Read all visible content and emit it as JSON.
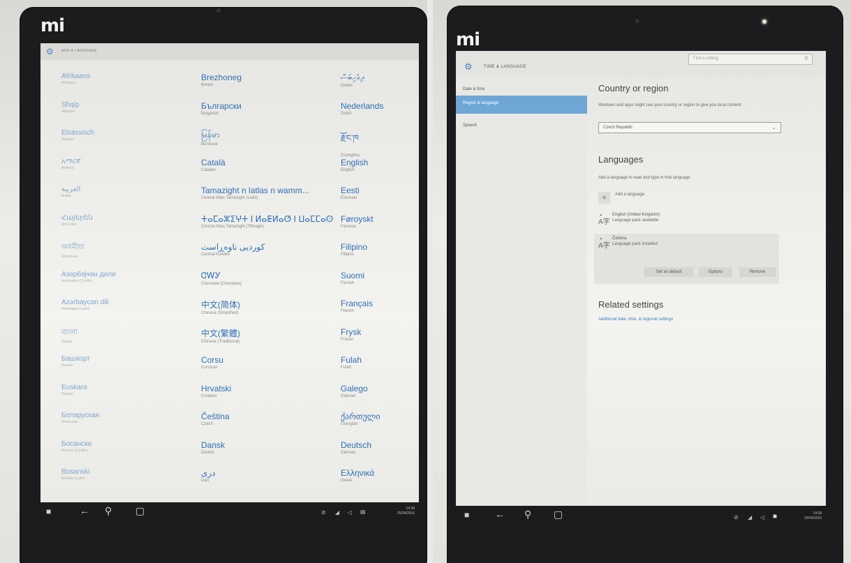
{
  "left_photo": {
    "brand": "mi",
    "header_title": "ADD A LANGUAGE",
    "columns": [
      [
        {
          "name": "Afrikaans",
          "sub": "Afrikaans"
        },
        {
          "name": "Shqip",
          "sub": "Albanian"
        },
        {
          "name": "Elsässisch",
          "sub": "Alsatian"
        },
        {
          "name": "አማርኛ",
          "sub": "Amharic"
        },
        {
          "name": "العربية",
          "sub": "Arabic"
        },
        {
          "name": "Հայերեն",
          "sub": "Armenian"
        },
        {
          "name": "অসমীয়া",
          "sub": "Assamese"
        },
        {
          "name": "Азәрбајҹан дили",
          "sub": "Azerbaijani (Cyrillic)"
        },
        {
          "name": "Azərbaycan dili",
          "sub": "Azerbaijani (Latin)"
        },
        {
          "name": "বাংলা",
          "sub": "Bangla"
        },
        {
          "name": "Башҡорт",
          "sub": "Bashkir"
        },
        {
          "name": "Euskara",
          "sub": "Basque"
        },
        {
          "name": "Беларуская",
          "sub": "Belarusian"
        },
        {
          "name": "Босански",
          "sub": "Bosnian (Cyrillic)"
        },
        {
          "name": "Bosanski",
          "sub": "Bosnian (Latin)"
        }
      ],
      [
        {
          "name": "Brezhoneg",
          "sub": "Breton"
        },
        {
          "name": "Български",
          "sub": "Bulgarian"
        },
        {
          "name": "မြန်မာ",
          "sub": "Burmese"
        },
        {
          "name": "Català",
          "sub": "Catalan"
        },
        {
          "name": "Tamazight n latlas n wamm...",
          "sub": "Central Atlas Tamazight (Latin)"
        },
        {
          "name": "ⵜⴰⵎⴰⵣⵉⵖⵜ ⵏ ⵍⴰⵟⵍⴰⵚ ⵏ ⵡⴰⵎⵎⴰⵙ",
          "sub": "Central Atlas Tamazight (Tifinagh)"
        },
        {
          "name": "کوردیی ناوەڕاست",
          "sub": "Central Kurdish"
        },
        {
          "name": "ᏣᎳᎩ",
          "sub": "Cherokee (Cherokee)"
        },
        {
          "name": "中文(简体)",
          "sub": "Chinese (Simplified)"
        },
        {
          "name": "中文(繁體)",
          "sub": "Chinese (Traditional)"
        },
        {
          "name": "Corsu",
          "sub": "Corsican"
        },
        {
          "name": "Hrvatski",
          "sub": "Croatian"
        },
        {
          "name": "Čeština",
          "sub": "Czech"
        },
        {
          "name": "Dansk",
          "sub": "Danish"
        },
        {
          "name": "دری",
          "sub": "Dari"
        }
      ],
      [
        {
          "name": "ދިވެހިބަސް",
          "sub": "Divehi"
        },
        {
          "name": "Nederlands",
          "sub": "Dutch"
        },
        {
          "name": "རྫོང་ཁ",
          "sub": "Dzongkha"
        },
        {
          "name": "English",
          "sub": "English"
        },
        {
          "name": "Eesti",
          "sub": "Estonian"
        },
        {
          "name": "Føroyskt",
          "sub": "Faroese"
        },
        {
          "name": "Filipino",
          "sub": "Filipino"
        },
        {
          "name": "Suomi",
          "sub": "Finnish"
        },
        {
          "name": "Français",
          "sub": "French"
        },
        {
          "name": "Frysk",
          "sub": "Frisian"
        },
        {
          "name": "Fulah",
          "sub": "Fulah"
        },
        {
          "name": "Galego",
          "sub": "Galician"
        },
        {
          "name": "ქართული",
          "sub": "Georgian"
        },
        {
          "name": "Deutsch",
          "sub": "German"
        },
        {
          "name": "Ελληνικά",
          "sub": "Greek"
        }
      ]
    ],
    "taskbar_time": "14:38",
    "taskbar_date": "25/04/2016"
  },
  "right_photo": {
    "brand": "mi",
    "header_title": "TIME & LANGUAGE",
    "search_placeholder": "Find a setting",
    "nav": [
      "Date & time",
      "Region & language",
      "Speech"
    ],
    "country_heading": "Country or region",
    "country_desc": "Windows and apps might use your country or region to give you local content",
    "country_value": "Czech Republic",
    "languages_heading": "Languages",
    "languages_desc": "Add a language to read and type in that language",
    "add_language": "Add a language",
    "languages": [
      {
        "name": "English (United Kingdom)",
        "status": "Language pack available"
      },
      {
        "name": "Čeština",
        "status": "Language pack installed"
      }
    ],
    "buttons": {
      "default": "Set as default",
      "options": "Options",
      "remove": "Remove"
    },
    "related_heading": "Related settings",
    "related_link": "Additional date, time, & regional settings",
    "taskbar_time": "14:38",
    "taskbar_date": "25/04/2016"
  }
}
